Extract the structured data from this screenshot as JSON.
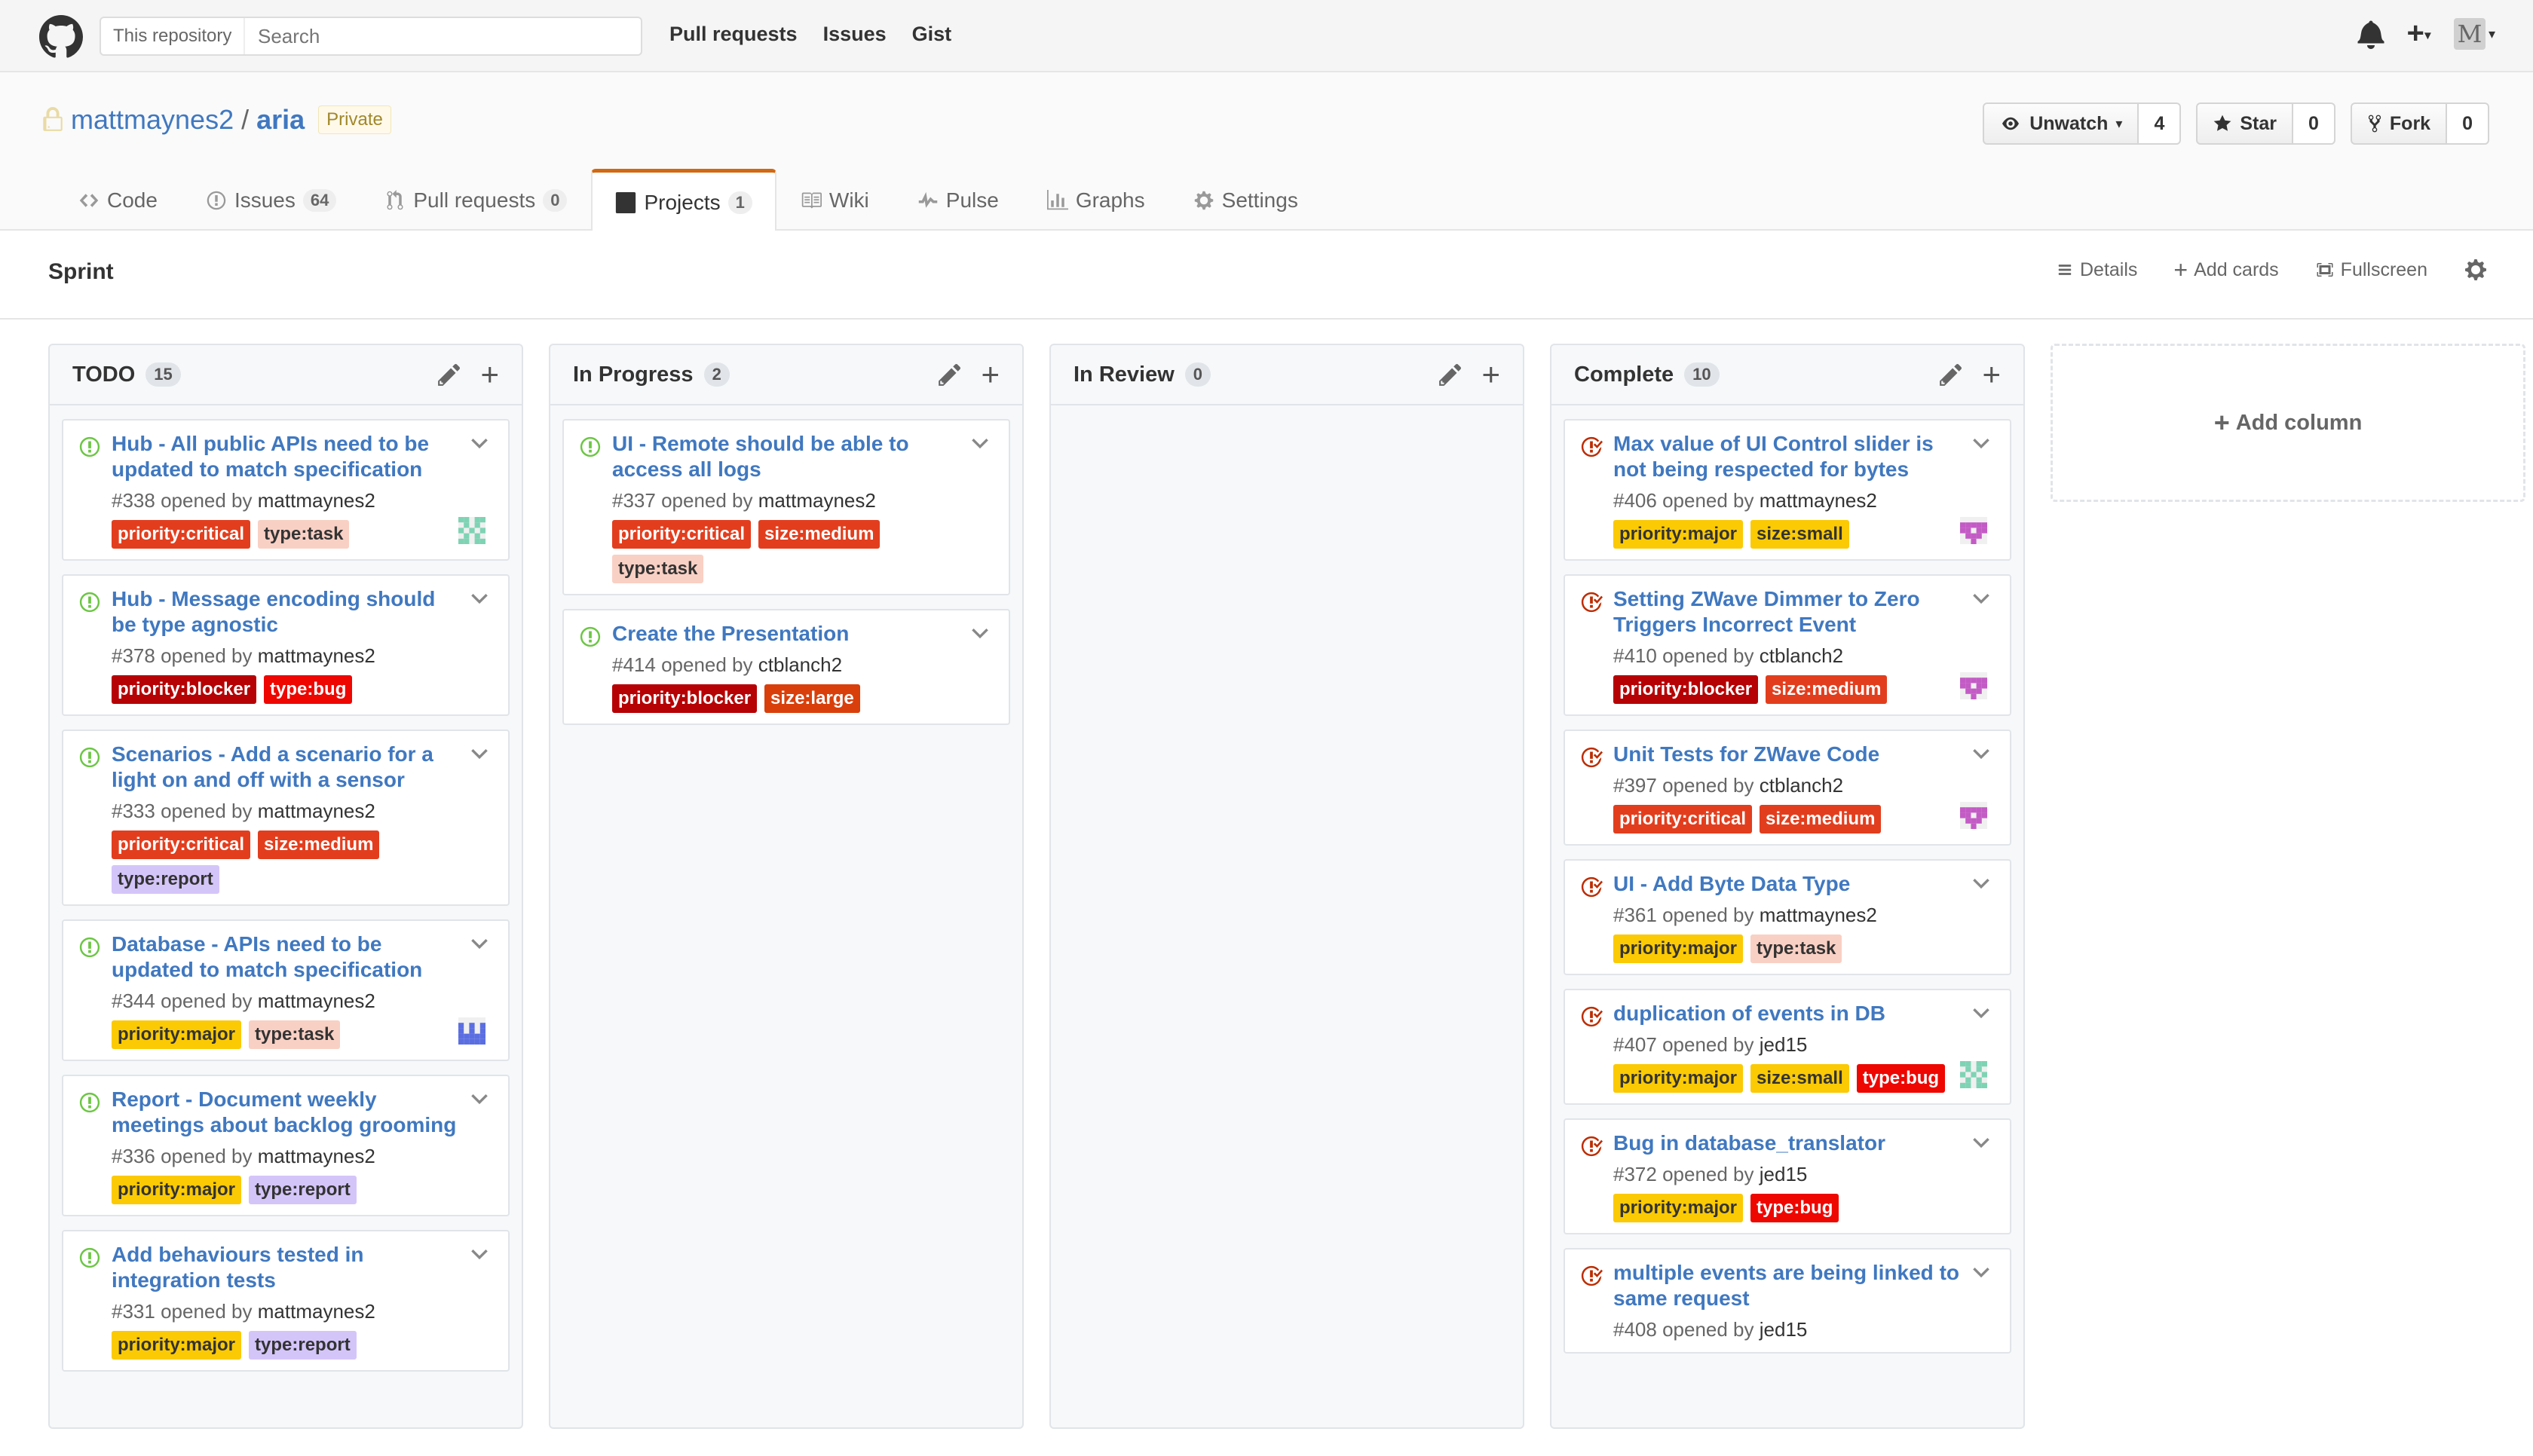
{
  "header": {
    "search_scope": "This repository",
    "search_placeholder": "Search",
    "nav": [
      "Pull requests",
      "Issues",
      "Gist"
    ],
    "avatar_letter": "M"
  },
  "repo": {
    "owner": "mattmaynes2",
    "separator": "/",
    "name": "aria",
    "visibility": "Private",
    "watch_label": "Unwatch",
    "watch_count": "4",
    "star_label": "Star",
    "star_count": "0",
    "fork_label": "Fork",
    "fork_count": "0"
  },
  "reponav": [
    {
      "label": "Code",
      "icon": "code-icon"
    },
    {
      "label": "Issues",
      "count": "64",
      "icon": "issue-icon"
    },
    {
      "label": "Pull requests",
      "count": "0",
      "icon": "pull-request-icon"
    },
    {
      "label": "Projects",
      "count": "1",
      "icon": "project-icon",
      "selected": true
    },
    {
      "label": "Wiki",
      "icon": "book-icon"
    },
    {
      "label": "Pulse",
      "icon": "pulse-icon"
    },
    {
      "label": "Graphs",
      "icon": "graph-icon"
    },
    {
      "label": "Settings",
      "icon": "gear-icon"
    }
  ],
  "project": {
    "title": "Sprint",
    "details_label": "Details",
    "add_cards_label": "Add cards",
    "fullscreen_label": "Fullscreen"
  },
  "columns": [
    {
      "name": "TODO",
      "count": "15",
      "cards": [
        {
          "title": "Hub - All public APIs need to be updated to match specification",
          "number": "#338",
          "opened_by": "opened by",
          "user": "mattmaynes2",
          "state": "open",
          "labels": [
            [
              "priority:critical",
              "critical"
            ],
            [
              "type:task",
              "task"
            ]
          ],
          "avatar": "teal"
        },
        {
          "title": "Hub - Message encoding should be type agnostic",
          "number": "#378",
          "opened_by": "opened by",
          "user": "mattmaynes2",
          "state": "open",
          "labels": [
            [
              "priority:blocker",
              "blocker"
            ],
            [
              "type:bug",
              "bug"
            ]
          ]
        },
        {
          "title": "Scenarios - Add a scenario for a light on and off with a sensor",
          "number": "#333",
          "opened_by": "opened by",
          "user": "mattmaynes2",
          "state": "open",
          "labels": [
            [
              "priority:critical",
              "critical"
            ],
            [
              "size:medium",
              "medium"
            ],
            [
              "type:report",
              "report"
            ]
          ]
        },
        {
          "title": "Database - APIs need to be updated to match specification",
          "number": "#344",
          "opened_by": "opened by",
          "user": "mattmaynes2",
          "state": "open",
          "labels": [
            [
              "priority:major",
              "major"
            ],
            [
              "type:task",
              "task"
            ]
          ],
          "avatar": "blue"
        },
        {
          "title": "Report - Document weekly meetings about backlog grooming",
          "number": "#336",
          "opened_by": "opened by",
          "user": "mattmaynes2",
          "state": "open",
          "labels": [
            [
              "priority:major",
              "major"
            ],
            [
              "type:report",
              "report"
            ]
          ]
        },
        {
          "title": "Add behaviours tested in integration tests",
          "number": "#331",
          "opened_by": "opened by",
          "user": "mattmaynes2",
          "state": "open",
          "labels": [
            [
              "priority:major",
              "major"
            ],
            [
              "type:report",
              "report"
            ]
          ]
        }
      ]
    },
    {
      "name": "In Progress",
      "count": "2",
      "cards": [
        {
          "title": "UI - Remote should be able to access all logs",
          "number": "#337",
          "opened_by": "opened by",
          "user": "mattmaynes2",
          "state": "open",
          "labels": [
            [
              "priority:critical",
              "critical"
            ],
            [
              "size:medium",
              "medium"
            ],
            [
              "type:task",
              "task"
            ]
          ]
        },
        {
          "title": "Create the Presentation",
          "number": "#414",
          "opened_by": "opened by",
          "user": "ctblanch2",
          "state": "open",
          "labels": [
            [
              "priority:blocker",
              "blocker"
            ],
            [
              "size:large",
              "large"
            ]
          ]
        }
      ]
    },
    {
      "name": "In Review",
      "count": "0",
      "cards": []
    },
    {
      "name": "Complete",
      "count": "10",
      "cards": [
        {
          "title": "Max value of UI Control slider is not being respected for bytes",
          "number": "#406",
          "opened_by": "opened by",
          "user": "mattmaynes2",
          "state": "closed",
          "labels": [
            [
              "priority:major",
              "major"
            ],
            [
              "size:small",
              "small"
            ]
          ],
          "avatar": "pink"
        },
        {
          "title": "Setting ZWave Dimmer to Zero Triggers Incorrect Event",
          "number": "#410",
          "opened_by": "opened by",
          "user": "ctblanch2",
          "state": "closed",
          "labels": [
            [
              "priority:blocker",
              "blocker"
            ],
            [
              "size:medium",
              "medium"
            ]
          ],
          "avatar": "pink"
        },
        {
          "title": "Unit Tests for ZWave Code",
          "number": "#397",
          "opened_by": "opened by",
          "user": "ctblanch2",
          "state": "closed",
          "labels": [
            [
              "priority:critical",
              "critical"
            ],
            [
              "size:medium",
              "medium"
            ]
          ],
          "avatar": "pink"
        },
        {
          "title": "UI - Add Byte Data Type",
          "number": "#361",
          "opened_by": "opened by",
          "user": "mattmaynes2",
          "state": "closed",
          "labels": [
            [
              "priority:major",
              "major"
            ],
            [
              "type:task",
              "task"
            ]
          ]
        },
        {
          "title": "duplication of events in DB",
          "number": "#407",
          "opened_by": "opened by",
          "user": "jed15",
          "state": "closed",
          "labels": [
            [
              "priority:major",
              "major"
            ],
            [
              "size:small",
              "small"
            ],
            [
              "type:bug",
              "bug"
            ]
          ],
          "avatar": "teal"
        },
        {
          "title": "Bug in database_translator",
          "number": "#372",
          "opened_by": "opened by",
          "user": "jed15",
          "state": "closed",
          "labels": [
            [
              "priority:major",
              "major"
            ],
            [
              "type:bug",
              "bug"
            ]
          ]
        },
        {
          "title": "multiple events are being linked to same request",
          "number": "#408",
          "opened_by": "opened by",
          "user": "jed15",
          "state": "closed",
          "labels": []
        }
      ]
    }
  ],
  "add_column_label": "Add column",
  "colors": {
    "link": "#4078c0",
    "open_icon": "#6cc644",
    "closed_icon": "#bd2c00",
    "tab_accent": "#d26911"
  }
}
